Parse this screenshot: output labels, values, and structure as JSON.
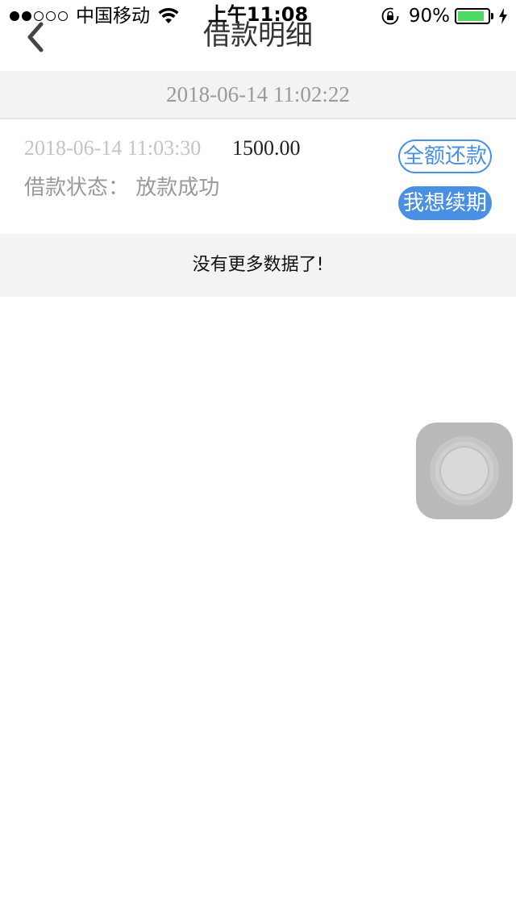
{
  "status_bar": {
    "carrier": "中国移动",
    "time": "上午11:08",
    "battery_percent": "90%",
    "battery_level": 0.9,
    "battery_color": "#4cd964",
    "signal_bars_filled": 2,
    "signal_bars_total": 5,
    "icons": [
      "wifi-icon",
      "orientation-lock-icon",
      "battery-icon",
      "charging-bolt-icon"
    ]
  },
  "nav": {
    "title": "借款明细",
    "back_icon": "chevron-left-icon"
  },
  "date_header": "2018-06-14 11:02:22",
  "loan": {
    "time": "2018-06-14 11:03:30",
    "amount": "1500.00",
    "status": "借款状态：  放款成功",
    "repay_label": "全额还款",
    "renew_label": "我想续期"
  },
  "footer_text": "没有更多数据了!",
  "colors": {
    "accent": "#4a90e2",
    "band_bg": "#f3f3f3"
  },
  "assistive_touch_icon": "assistive-touch-icon"
}
